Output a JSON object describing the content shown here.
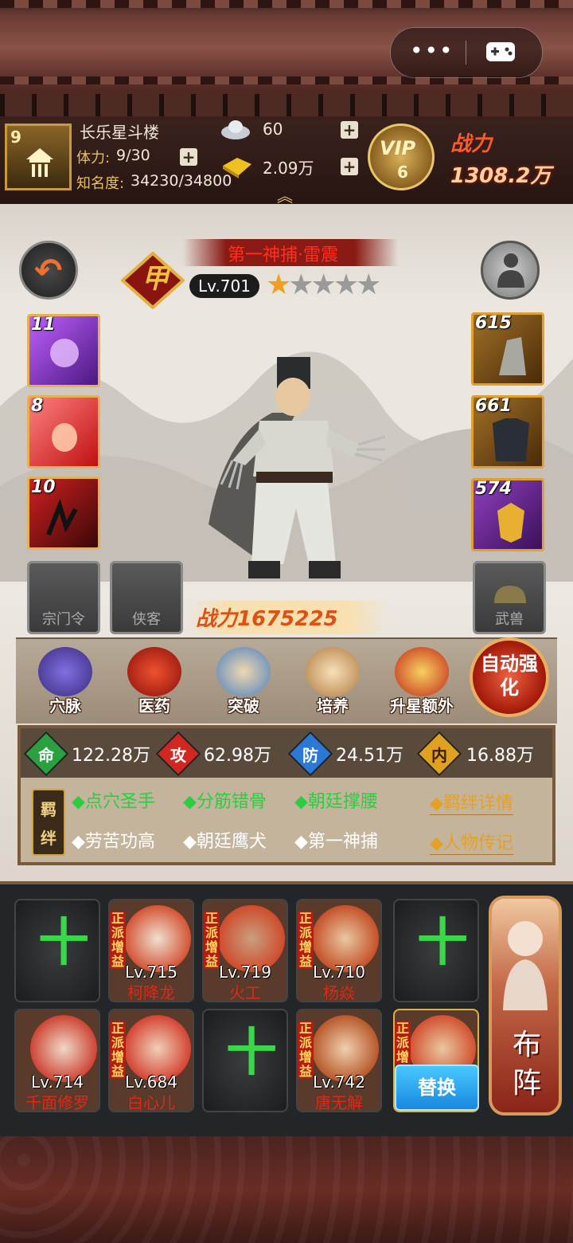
{
  "player": {
    "badge_level": "9",
    "name": "长乐星斗楼",
    "stamina_label": "体力:",
    "stamina": "9/30",
    "fame_label": "知名度:",
    "fame": "34230/34800"
  },
  "currency": {
    "silver": "60",
    "gold": "2.09万"
  },
  "vip": {
    "label": "VIP",
    "level": "6"
  },
  "top_power": {
    "label": "战力",
    "value": "1308.2万"
  },
  "hero": {
    "rank_badge": "甲",
    "title": "第一神捕·雷震",
    "level": "Lv.701",
    "stars_on": "★",
    "stars_off": "★★★★",
    "power": "战力1675225"
  },
  "skills": [
    {
      "level": "11"
    },
    {
      "level": "8"
    },
    {
      "level": "10"
    }
  ],
  "equipment": [
    {
      "level": "615"
    },
    {
      "level": "661"
    },
    {
      "level": "574"
    }
  ],
  "slots": {
    "sect_token": "宗门令",
    "companion": "侠客",
    "weapon_box": "武兽"
  },
  "functions": [
    {
      "label": "穴脉",
      "icon": "meridian-icon"
    },
    {
      "label": "医药",
      "icon": "medicine-icon"
    },
    {
      "label": "突破",
      "icon": "breakthrough-icon"
    },
    {
      "label": "培养",
      "icon": "cultivate-icon"
    },
    {
      "label": "升星额外",
      "icon": "star-up-icon"
    }
  ],
  "auto_strengthen": "自动强化",
  "attributes": [
    {
      "key": "命",
      "value": "122.28万",
      "color": "#2aa040"
    },
    {
      "key": "攻",
      "value": "62.98万",
      "color": "#d02820"
    },
    {
      "key": "防",
      "value": "24.51万",
      "color": "#2a78d8"
    },
    {
      "key": "内",
      "value": "16.88万",
      "color": "#e0a020"
    }
  ],
  "bonds": {
    "badge": "羁绊",
    "active": [
      "◆点穴圣手",
      "◆分筋错骨",
      "◆朝廷撑腰"
    ],
    "inactive": [
      "◆劳苦功高",
      "◆朝廷鹰犬",
      "◆第一神捕"
    ],
    "detail_link": "◆羁绊详情",
    "biography_link": "◆人物传记"
  },
  "lineup": [
    {
      "empty": true
    },
    {
      "tag": "正派增益",
      "level": "Lv.715",
      "name": "柯降龙"
    },
    {
      "tag": "正派增益",
      "level": "Lv.719",
      "name": "火工"
    },
    {
      "tag": "正派增益",
      "level": "Lv.710",
      "name": "杨焱"
    },
    {
      "empty": true
    },
    {
      "level": "Lv.714",
      "name": "千面修罗"
    },
    {
      "tag": "正派增益",
      "level": "Lv.684",
      "name": "白心儿"
    },
    {
      "empty": true
    },
    {
      "tag": "正派增益",
      "level": "Lv.742",
      "name": "唐无解"
    },
    {
      "tag": "正派增"
    }
  ],
  "add_symbol": "十",
  "replace_button": "替换",
  "formation_button": "布阵",
  "capsule": {
    "more": "•••"
  }
}
